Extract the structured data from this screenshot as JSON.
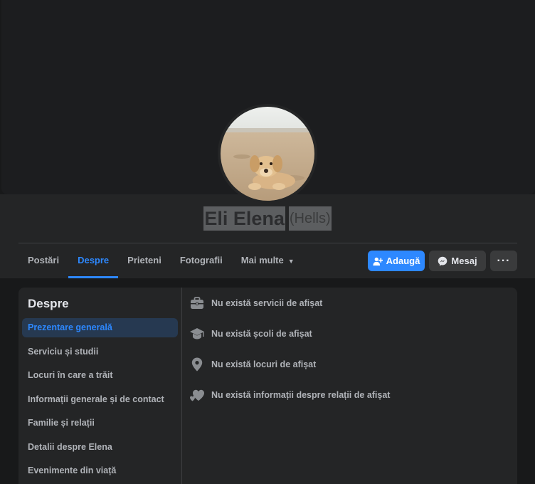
{
  "profile": {
    "name": "Eli Elena",
    "alternate_name": "(Hells)"
  },
  "tabs": [
    {
      "label": "Postări",
      "active": false
    },
    {
      "label": "Despre",
      "active": true
    },
    {
      "label": "Prieteni",
      "active": false
    },
    {
      "label": "Fotografii",
      "active": false
    },
    {
      "label": "Mai multe",
      "active": false
    }
  ],
  "actions": {
    "add_label": "Adaugă",
    "message_label": "Mesaj",
    "more_label": "···"
  },
  "about": {
    "title": "Despre",
    "menu": [
      {
        "label": "Prezentare generală",
        "active": true
      },
      {
        "label": "Serviciu și studii",
        "active": false
      },
      {
        "label": "Locuri în care a trăit",
        "active": false
      },
      {
        "label": "Informații generale și de contact",
        "active": false
      },
      {
        "label": "Familie și relații",
        "active": false
      },
      {
        "label": "Detalii despre Elena",
        "active": false
      },
      {
        "label": "Evenimente din viață",
        "active": false
      }
    ],
    "items": [
      {
        "icon": "briefcase-icon",
        "text": "Nu există servicii de afișat"
      },
      {
        "icon": "graduation-cap-icon",
        "text": "Nu există școli de afișat"
      },
      {
        "icon": "location-pin-icon",
        "text": "Nu există locuri de afișat"
      },
      {
        "icon": "hearts-icon",
        "text": "Nu există informații despre relații de afișat"
      }
    ]
  },
  "colors": {
    "accent": "#2d88ff",
    "background": "#18191a",
    "surface": "#242526"
  }
}
